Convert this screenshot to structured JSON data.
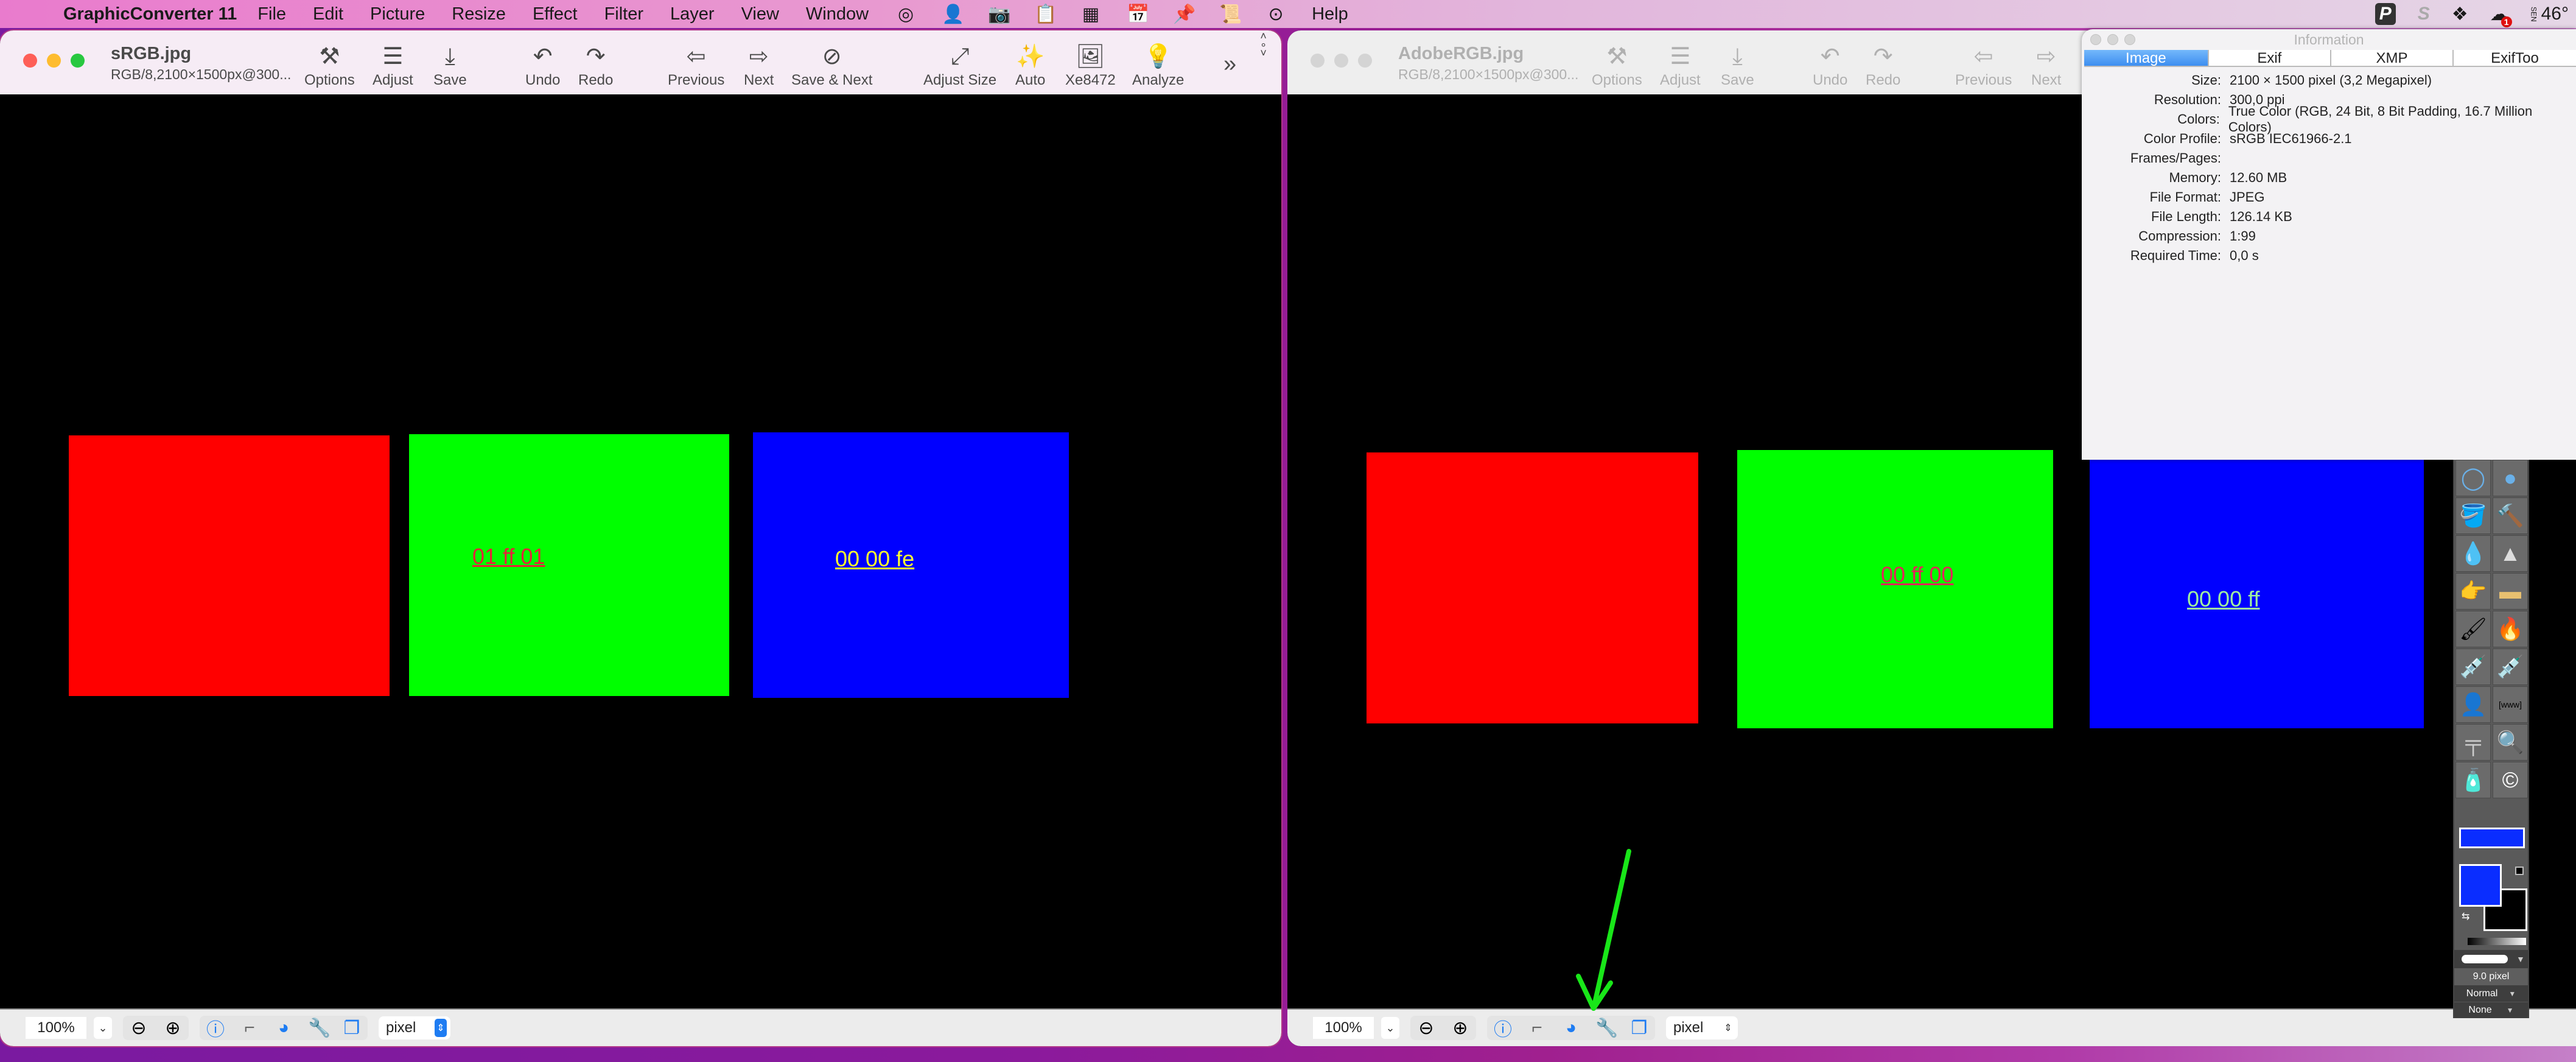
{
  "menubar": {
    "apple": "",
    "app_name": "GraphicConverter 11",
    "items": [
      "File",
      "Edit",
      "Picture",
      "Resize",
      "Effect",
      "Filter",
      "Layer",
      "View",
      "Window"
    ],
    "icons": [
      "target-icon",
      "person-icon",
      "camera-icon",
      "clipboard-icon",
      "box-icon",
      "calendar-icon",
      "pin-icon",
      "scroll-icon",
      "more-icon"
    ],
    "help": "Help",
    "status_icons": [
      "p-app-icon",
      "s-app-icon",
      "dropbox-icon",
      "cloud-icon",
      "weather-icon"
    ],
    "cloud_badge": "1",
    "weather_dir": "SEN",
    "temperature": "46°"
  },
  "window_left": {
    "filename": "sRGB.jpg",
    "subtitle": "RGB/8,2100×1500px@300...",
    "toolbar": [
      "Options",
      "Adjust",
      "Save",
      "Undo",
      "Redo",
      "Previous",
      "Next",
      "Save & Next",
      "Adjust Size",
      "Auto",
      "Xe8472",
      "Analyze"
    ],
    "overflow": "»",
    "swatches": [
      {
        "color": "#ff0000",
        "label": ""
      },
      {
        "color": "#00ff00",
        "label": "01 ff 01",
        "label_color": "#e8203a"
      },
      {
        "color": "#0000ff",
        "label": "00 00 fe",
        "label_color": "#ffff30"
      }
    ],
    "zoom": "100%",
    "unit": "pixel"
  },
  "window_right": {
    "filename": "AdobeRGB.jpg",
    "subtitle": "RGB/8,2100×1500px@300...",
    "toolbar": [
      "Options",
      "Adjust",
      "Save",
      "Undo",
      "Redo",
      "Previous",
      "Next"
    ],
    "swatches": [
      {
        "color": "#ff0000",
        "label": ""
      },
      {
        "color": "#00ff00",
        "label": "00 ff 00",
        "label_color": "#e8205a"
      },
      {
        "color": "#0000ff",
        "label": "00 00 ff",
        "label_color": "#a0f0a0"
      }
    ],
    "zoom": "100%",
    "unit": "pixel"
  },
  "info_panel": {
    "title": "Information",
    "tabs": [
      "Image",
      "Exif",
      "XMP",
      "ExifToo"
    ],
    "active_tab": "Image",
    "rows": [
      {
        "k": "Size:",
        "v": "2100 × 1500 pixel (3,2 Megapixel)"
      },
      {
        "k": "Resolution:",
        "v": "300,0 ppi"
      },
      {
        "k": "Colors:",
        "v": "True Color (RGB, 24 Bit, 8 Bit Padding, 16.7 Million Colors)"
      },
      {
        "k": "Color Profile:",
        "v": "sRGB IEC61966-2.1"
      },
      {
        "k": "Frames/Pages:",
        "v": ""
      },
      {
        "k": "Memory:",
        "v": "12.60 MB"
      },
      {
        "k": "File Format:",
        "v": "JPEG"
      },
      {
        "k": "File Length:",
        "v": "126.14 KB"
      },
      {
        "k": "Compression:",
        "v": "1:99"
      },
      {
        "k": "Required Time:",
        "v": "0,0 s"
      }
    ]
  },
  "palette": {
    "tools": [
      "ellipse-outline-icon",
      "ellipse-filled-icon",
      "paint-bucket-icon",
      "stamp-icon",
      "water-drop-icon",
      "sharpen-cone-icon",
      "smudge-finger-icon",
      "sponge-icon",
      "brush-icon",
      "burn-brush-icon",
      "eyedropper-icon",
      "eyedropper-fill-icon",
      "silhouette-icon",
      "text-frame-icon",
      "caliper-icon",
      "magnifier-icon",
      "glue-icon",
      "copyright-icon"
    ],
    "foreground_color": "#0a2dff",
    "background_color": "#000000",
    "brush_size": "9.0 pixel",
    "blend_mode": "Normal",
    "extra_mode": "None"
  },
  "annotation": {
    "color": "#19e619"
  }
}
